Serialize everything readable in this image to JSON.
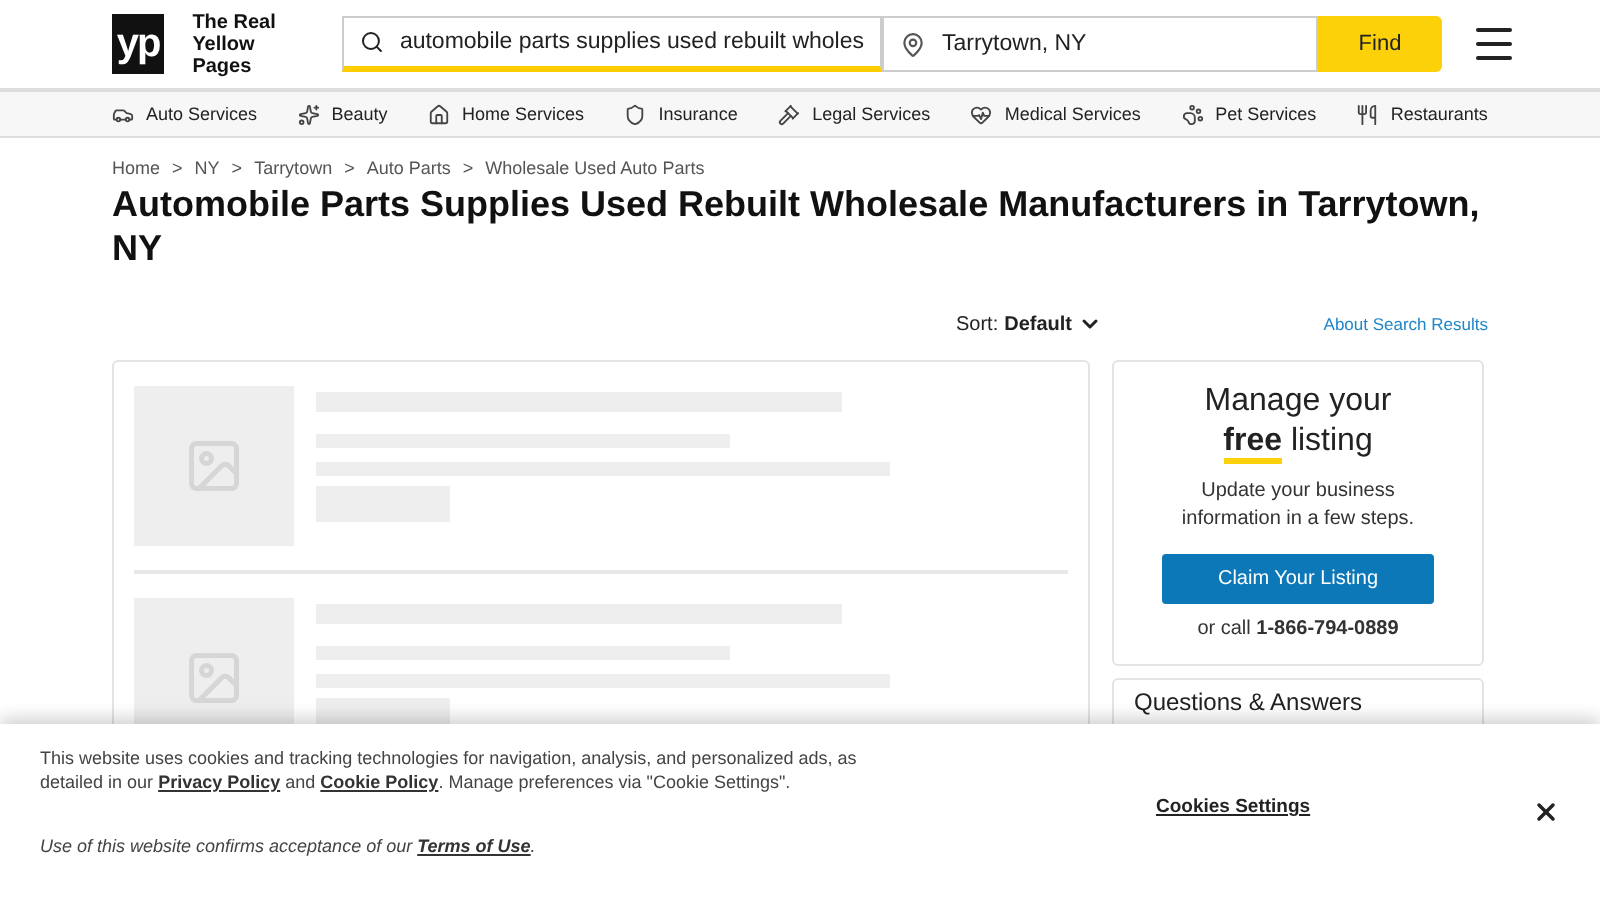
{
  "header": {
    "logo_mark": "yp",
    "logo_text": "The Real Yellow Pages",
    "search": {
      "value": "automobile parts supplies used rebuilt wholes"
    },
    "location": {
      "value": "Tarrytown, NY"
    },
    "find_button": "Find"
  },
  "categories": [
    {
      "label": "Auto Services",
      "kind": "car"
    },
    {
      "label": "Beauty",
      "kind": "beauty"
    },
    {
      "label": "Home Services",
      "kind": "home"
    },
    {
      "label": "Insurance",
      "kind": "shield"
    },
    {
      "label": "Legal Services",
      "kind": "gavel"
    },
    {
      "label": "Medical Services",
      "kind": "heart"
    },
    {
      "label": "Pet Services",
      "kind": "paw"
    },
    {
      "label": "Restaurants",
      "kind": "fork"
    }
  ],
  "breadcrumbs": [
    {
      "label": "Home"
    },
    {
      "separator": ">",
      "label": "NY"
    },
    {
      "separator": ">",
      "label": "Tarrytown"
    },
    {
      "separator": ">",
      "label": "Auto Parts"
    },
    {
      "separator": ">",
      "label": "Wholesale Used Auto Parts"
    }
  ],
  "title": "Automobile Parts Supplies Used Rebuilt Wholesale Manufacturers in Tarrytown, NY",
  "sort": {
    "label": "Sort:",
    "value": "Default"
  },
  "about_link": "About Search Results",
  "listing_card": {
    "heading": "Manage your **free** listing",
    "text": "Update your business information in a few steps.",
    "button": "Claim Your Listing",
    "call": "or call **1-866-794-0889**"
  },
  "qa_card": {
    "heading": "Questions & Answers"
  },
  "cookie_banner": {
    "text": "This website uses cookies and tracking technologies for navigation, analysis, and personalized ads, as detailed in our",
    "privacy_link": "Privacy Policy",
    "and": "and",
    "cookie_link": "Cookie Policy",
    "manage": ". Manage preferences via \"Cookie Settings\".",
    "settings_button": "Cookies Settings",
    "terms_text": "Use of this website confirms acceptance of our",
    "terms_link": "Terms of Use",
    "terms_end": "."
  }
}
